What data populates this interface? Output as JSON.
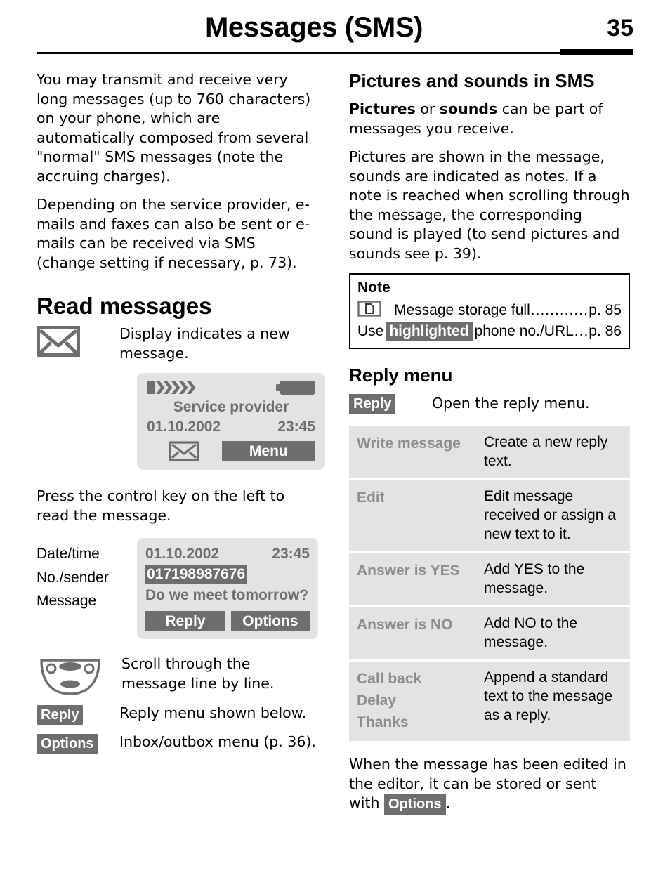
{
  "header": {
    "title": "Messages (SMS)",
    "page_number": "35"
  },
  "left_column": {
    "paragraph_1": "You may transmit and receive very long messages (up to 760 characters) on your phone, which are automatically composed from several \"normal\" SMS messages (note the accruing charges).",
    "paragraph_2": "Depending on the service provider, e-mails and faxes can also be sent or e-mails can be received via SMS (change setting if necessary, p. 73).",
    "section_heading": "Read messages",
    "envelope_row_text": "Display indicates a new message.",
    "phone_display_1": {
      "provider": "Service provider",
      "date": "01.10.2002",
      "time": "23:45",
      "left_softkey_icon": "envelope-icon",
      "right_softkey": "Menu"
    },
    "paragraph_3": "Press the control key on the left to read the message.",
    "display_labels": [
      "Date/time",
      "No./sender",
      "Message"
    ],
    "phone_display_2": {
      "date": "01.10.2002",
      "time": "23:45",
      "number": "017198987676",
      "message": "Do we meet tomorrow?",
      "left_softkey": "Reply",
      "right_softkey": "Options"
    },
    "key_rows": [
      {
        "key": "control-key-icon",
        "text": "Scroll through the message line by line."
      },
      {
        "key": "Reply",
        "text": "Reply menu shown below."
      },
      {
        "key": "Options",
        "text": "Inbox/outbox menu (p. 36)."
      }
    ]
  },
  "right_column": {
    "heading_pictures": "Pictures and sounds in SMS",
    "paragraph_1_bold_1": "Pictures",
    "paragraph_1_mid": " or ",
    "paragraph_1_bold_2": "sounds",
    "paragraph_1_rest": " can be part of messages you receive.",
    "paragraph_2": "Pictures are shown in the message, sounds are indicated as notes. If a note is reached when scrolling through the message, the corresponding sound is played (to send pictures and sounds see p. 39).",
    "note": {
      "title": "Note",
      "line_1_icon": "memory-full-icon",
      "line_1_text": "Message storage full",
      "line_1_page": "p. 85",
      "line_2_prefix": "Use ",
      "line_2_badge": "highlighted",
      "line_2_text": " phone no./URL ",
      "line_2_page": "p. 86"
    },
    "heading_reply_menu": "Reply menu",
    "reply_key": "Reply",
    "reply_key_desc": "Open the reply menu.",
    "menu_table": {
      "rows": [
        {
          "labels": [
            "Write message"
          ],
          "desc": "Create a new reply text."
        },
        {
          "labels": [
            "Edit"
          ],
          "desc": "Edit message received or assign a new text to it."
        },
        {
          "labels": [
            "Answer is YES"
          ],
          "desc": "Add YES to the message."
        },
        {
          "labels": [
            "Answer is NO"
          ],
          "desc": "Add NO to the message."
        },
        {
          "labels": [
            "Call back",
            "Delay",
            "Thanks"
          ],
          "desc": "Append a standard text to the message as a reply."
        }
      ]
    },
    "closing_prefix": "When the message has been edited in the editor, it can be stored or sent with ",
    "closing_badge": "Options",
    "closing_suffix": "."
  },
  "colors": {
    "display_background": "#e3e3e3",
    "display_text": "#6e6e6e",
    "softkey_background": "#6e6e6e",
    "softkey_text": "#ffffff",
    "table_label": "#8d8d8d",
    "page_text": "#000000"
  }
}
